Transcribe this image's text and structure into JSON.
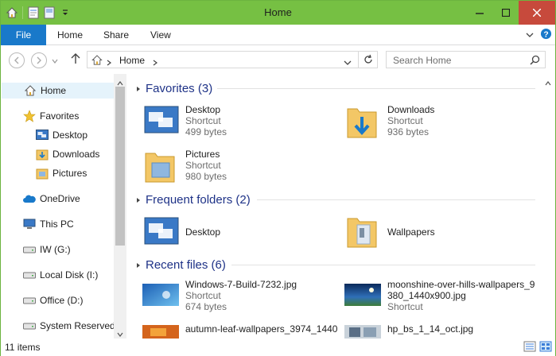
{
  "window": {
    "title": "Home"
  },
  "ribbon": {
    "tabs": {
      "file": "File",
      "home": "Home",
      "share": "Share",
      "view": "View"
    }
  },
  "address": {
    "crumb": "Home"
  },
  "search": {
    "placeholder": "Search Home"
  },
  "nav": {
    "home": "Home",
    "favorites": "Favorites",
    "desktop": "Desktop",
    "downloads": "Downloads",
    "pictures": "Pictures",
    "onedrive": "OneDrive",
    "thispc": "This PC",
    "iw": "IW (G:)",
    "localdisk": "Local Disk (I:)",
    "office": "Office (D:)",
    "systemreserved": "System Reserved"
  },
  "groups": {
    "favorites": "Favorites (3)",
    "frequent": "Frequent folders (2)",
    "recent": "Recent files (6)"
  },
  "favorites": [
    {
      "name": "Desktop",
      "type": "Shortcut",
      "size": "499 bytes"
    },
    {
      "name": "Downloads",
      "type": "Shortcut",
      "size": "936 bytes"
    },
    {
      "name": "Pictures",
      "type": "Shortcut",
      "size": "980 bytes"
    }
  ],
  "frequent": [
    {
      "name": "Desktop"
    },
    {
      "name": "Wallpapers"
    }
  ],
  "recent": [
    {
      "name": "Windows-7-Build-7232.jpg",
      "type": "Shortcut",
      "size": "674 bytes"
    },
    {
      "name": "moonshine-over-hills-wallpapers_9",
      "name2": "380_1440x900.jpg",
      "type": "Shortcut"
    },
    {
      "name": "autumn-leaf-wallpapers_3974_1440"
    },
    {
      "name": "hp_bs_1_14_oct.jpg"
    }
  ],
  "status": {
    "count": "11 items"
  },
  "colors": {
    "titlebar": "#76c043",
    "file_tab": "#1979ca",
    "group_head": "#1e3287",
    "selected": "#e5f3fb"
  }
}
